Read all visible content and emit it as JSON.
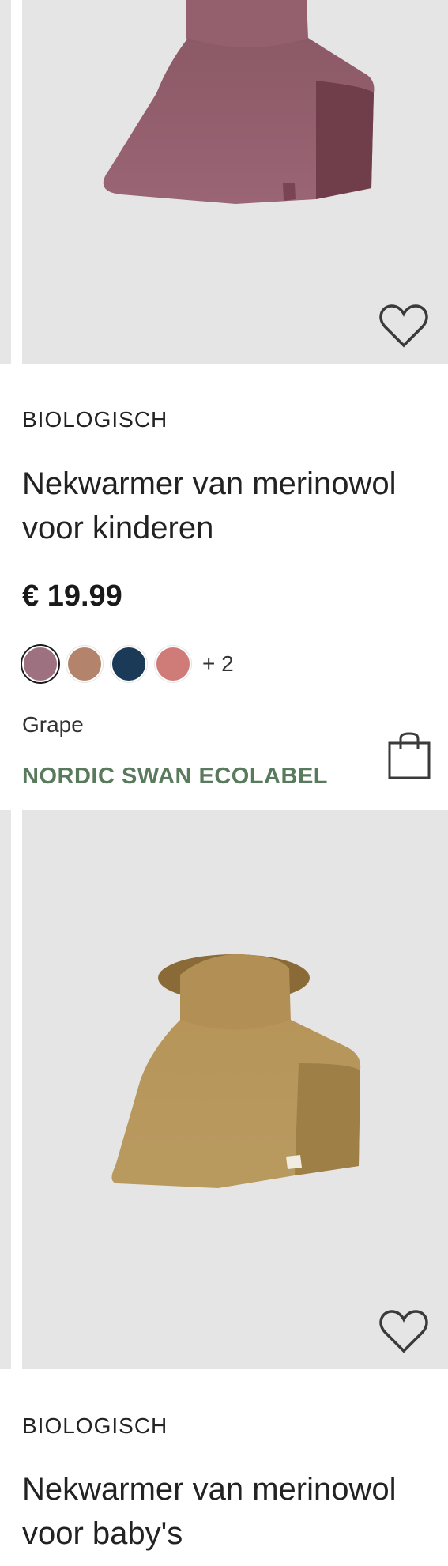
{
  "products": [
    {
      "label": "BIOLOGISCH",
      "title": "Nekwarmer van merinowol voor kinderen",
      "price": "€ 19.99",
      "swatches": [
        "#a57a8a",
        "#b58770",
        "#1b3a57",
        "#cf7c78"
      ],
      "more_colors": "+ 2",
      "selected_color": "Grape",
      "ecolabel": "NORDIC SWAN ECOLABEL",
      "product_color": "#8e5a66"
    },
    {
      "label": "BIOLOGISCH",
      "title": "Nekwarmer van merinowol voor baby's",
      "product_color": "#b8975a"
    }
  ],
  "icons": {
    "wishlist": "heart-icon",
    "cart": "shopping-bag-icon"
  }
}
